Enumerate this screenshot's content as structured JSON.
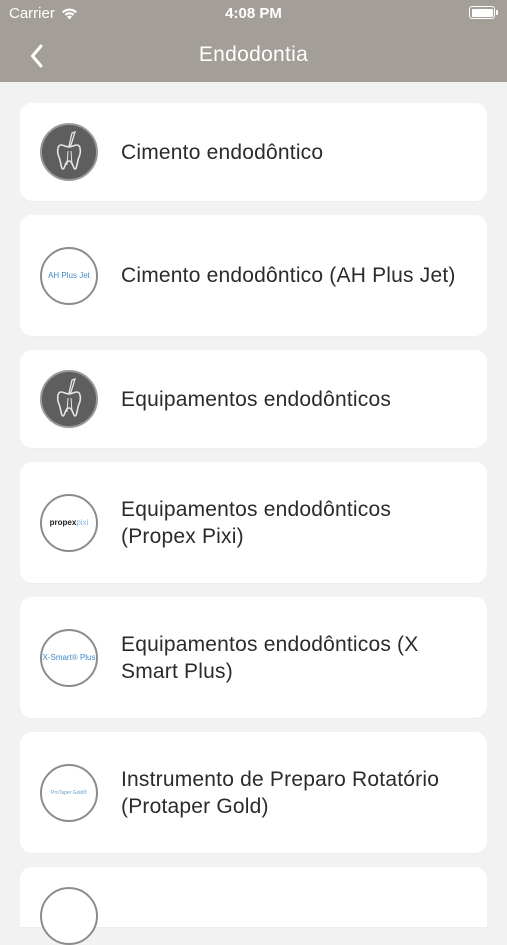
{
  "status_bar": {
    "carrier": "Carrier",
    "time": "4:08 PM"
  },
  "nav": {
    "title": "Endodontia"
  },
  "items": [
    {
      "label": "Cimento endodôntico",
      "logo": ""
    },
    {
      "label": "Cimento endodôntico (AH Plus Jet)",
      "logo": "AH Plus Jet"
    },
    {
      "label": "Equipamentos endodônticos",
      "logo": ""
    },
    {
      "label": "Equipamentos endodônticos (Propex Pixi)",
      "logo": "propex",
      "logo_suffix": "pixi"
    },
    {
      "label": "Equipamentos endodônticos (X Smart Plus)",
      "logo": "X-Smart® Plus"
    },
    {
      "label": "Instrumento de Preparo Rotatório (Protaper Gold)",
      "logo": "ProTaper Gold®"
    }
  ],
  "colors": {
    "header": "#a49e99",
    "background": "#f2f2f2",
    "card": "#ffffff",
    "logo_blue": "#3f89c9"
  }
}
